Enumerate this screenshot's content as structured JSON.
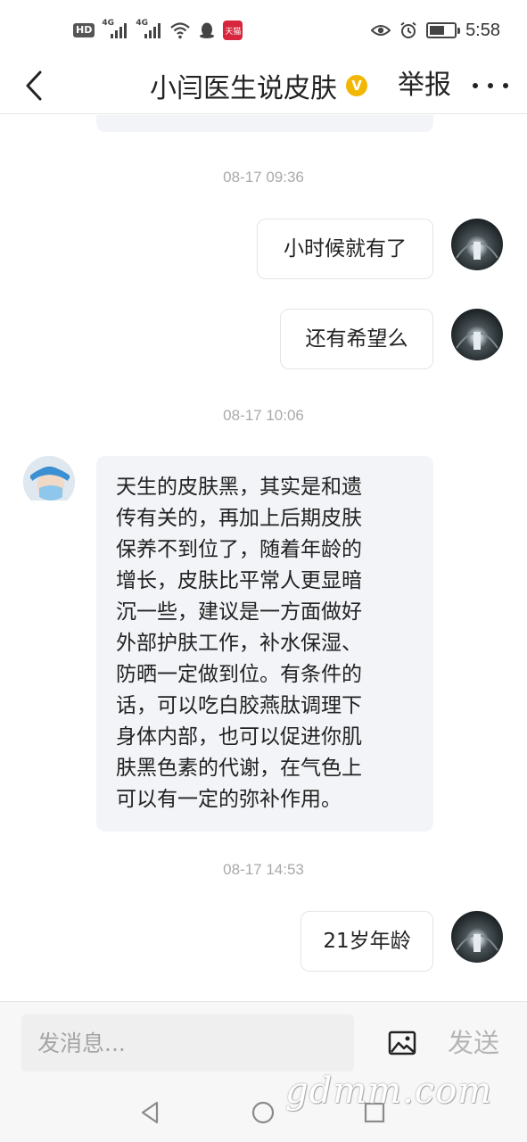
{
  "status_bar": {
    "hd": "HD",
    "net1": "4G",
    "net2": "4G",
    "app_badge": "天猫",
    "time": "5:58",
    "battery_level": 0.6
  },
  "header": {
    "title": "小闫医生说皮肤",
    "verified_badge": "V",
    "report_label": "举报"
  },
  "messages": [
    {
      "type": "timestamp",
      "text": "08-17 09:36"
    },
    {
      "type": "outgoing",
      "text": "小时候就有了"
    },
    {
      "type": "outgoing",
      "text": "还有希望么"
    },
    {
      "type": "timestamp",
      "text": "08-17 10:06"
    },
    {
      "type": "incoming",
      "lines": [
        "天生的皮肤黑，其实是和遗",
        "传有关的，再加上后期皮肤",
        "保养不到位了，随着年龄的",
        "增长，皮肤比平常人更显暗",
        "沉一些，建议是一方面做好",
        "外部护肤工作，补水保湿、",
        "防晒一定做到位。有条件的",
        "话，可以吃白胶燕肽调理下",
        "身体内部，也可以促进你肌",
        "肤黑色素的代谢，在气色上",
        "可以有一定的弥补作用。"
      ]
    },
    {
      "type": "timestamp",
      "text": "08-17 14:53"
    },
    {
      "type": "outgoing",
      "text": "21岁年龄"
    }
  ],
  "input": {
    "placeholder": "发消息...",
    "send_label": "发送"
  },
  "watermark": "gdmm.com"
}
